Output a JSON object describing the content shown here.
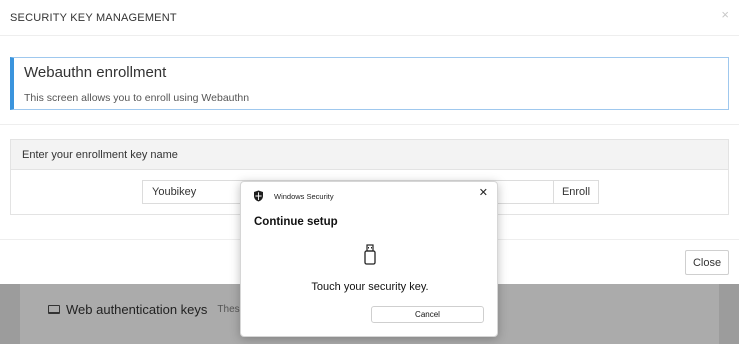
{
  "background": {
    "section_title": "Web authentication keys",
    "section_desc": "These are",
    "section_icon": "laptop-icon"
  },
  "modal": {
    "title": "SECURITY KEY MANAGEMENT",
    "close_icon": "×",
    "info": {
      "title": "Webauthn enrollment",
      "description": "This screen allows you to enroll using Webauthn"
    },
    "enroll_panel": {
      "heading": "Enter your enrollment key name",
      "input_value": "Youbikey",
      "enroll_label": "Enroll"
    },
    "close_label": "Close"
  },
  "windows_security": {
    "app_name": "Windows Security",
    "close_icon": "✕",
    "heading": "Continue setup",
    "message": "Touch your security key.",
    "cancel_label": "Cancel"
  },
  "colors": {
    "accent_border": "#3a94dd",
    "info_border": "#9fc8ee",
    "overlay": "#9c9c9c"
  }
}
